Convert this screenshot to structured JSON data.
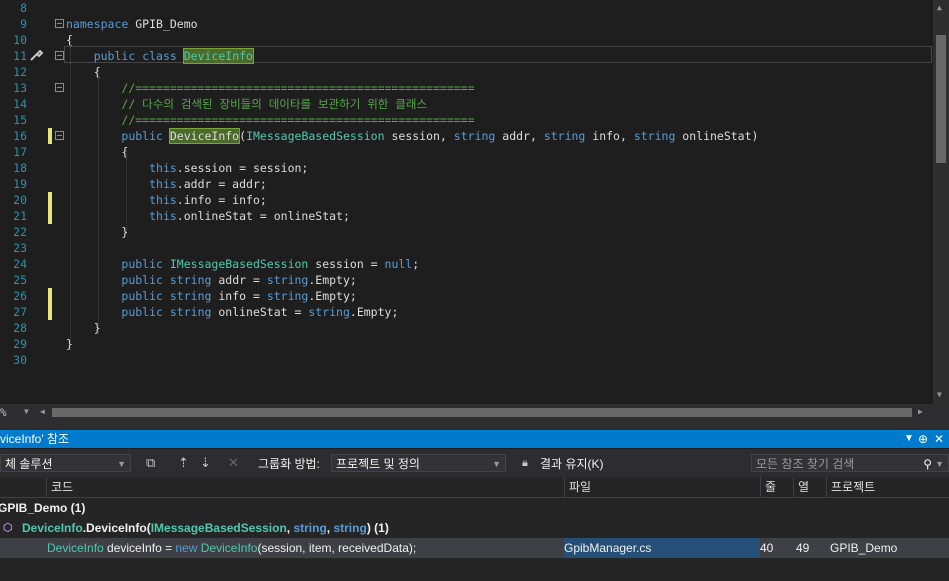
{
  "editor": {
    "lines": [
      {
        "n": "8",
        "html": ""
      },
      {
        "n": "9",
        "html": "<span class=\"kw\">namespace</span> GPIB_Demo"
      },
      {
        "n": "10",
        "html": "{"
      },
      {
        "n": "11",
        "html": "    <span class=\"kw\">public</span> <span class=\"kw\">class</span> <span class=\"ty hl\">DeviceInfo</span>"
      },
      {
        "n": "12",
        "html": "    {"
      },
      {
        "n": "13",
        "html": "        <span class=\"cm\">//=================================================</span>"
      },
      {
        "n": "14",
        "html": "        <span class=\"cm\">// 다수의 검색된 장비들의 데이타를 보관하기 위한 클래스</span>"
      },
      {
        "n": "15",
        "html": "        <span class=\"cm\">//=================================================</span>"
      },
      {
        "n": "16",
        "html": "        <span class=\"kw\">public</span> <span class=\"hl\">DeviceInfo</span>(<span class=\"ty\">IMessageBasedSession</span> session, <span class=\"kw\">string</span> addr, <span class=\"kw\">string</span> info, <span class=\"kw\">string</span> onlineStat)"
      },
      {
        "n": "17",
        "html": "        {"
      },
      {
        "n": "18",
        "html": "            <span class=\"kw\">this</span>.session = session;"
      },
      {
        "n": "19",
        "html": "            <span class=\"kw\">this</span>.addr = addr;"
      },
      {
        "n": "20",
        "html": "            <span class=\"kw\">this</span>.info = info;"
      },
      {
        "n": "21",
        "html": "            <span class=\"kw\">this</span>.onlineStat = onlineStat;"
      },
      {
        "n": "22",
        "html": "        }"
      },
      {
        "n": "23",
        "html": ""
      },
      {
        "n": "24",
        "html": "        <span class=\"kw\">public</span> <span class=\"ty\">IMessageBasedSession</span> session = <span class=\"kw\">null</span>;"
      },
      {
        "n": "25",
        "html": "        <span class=\"kw\">public</span> <span class=\"kw\">string</span> addr = <span class=\"kw\">string</span>.Empty;"
      },
      {
        "n": "26",
        "html": "        <span class=\"kw\">public</span> <span class=\"kw\">string</span> info = <span class=\"kw\">string</span>.Empty;"
      },
      {
        "n": "27",
        "html": "        <span class=\"kw\">public</span> <span class=\"kw\">string</span> onlineStat = <span class=\"kw\">string</span>.Empty;"
      },
      {
        "n": "28",
        "html": "    }"
      },
      {
        "n": "29",
        "html": "}"
      },
      {
        "n": "30",
        "html": ""
      }
    ],
    "zoom": "%"
  },
  "panel": {
    "title": "viceInfo' 참조",
    "title_icons": [
      "▾",
      "⊕",
      "✕"
    ]
  },
  "toolbar": {
    "scope": "체 솔루션",
    "group_label": "그룹화 방법:",
    "group_value": "프로젝트 및 정의",
    "keep_results": "결과 유지(K)",
    "search_placeholder": "모든 참조 찾기 검색"
  },
  "columns": {
    "code": "코드",
    "file": "파일",
    "line": "줄",
    "col": "열",
    "project": "프로젝트"
  },
  "results": {
    "project_group": "GPIB_Demo (1)",
    "definition_name": "DeviceInfo",
    "definition_dot": ".DeviceInfo(",
    "definition_type": "IMessageBasedSession",
    "definition_sep1": ", ",
    "definition_str1": "string",
    "definition_sep2": ", ",
    "definition_str2": "string",
    "definition_tail": ")",
    "definition_count": "(1)",
    "row": {
      "code_type": "DeviceInfo",
      "code_var": " deviceInfo = ",
      "code_new": "new ",
      "code_ctor": "DeviceInfo",
      "code_args": "(session, item, receivedData);",
      "file": "GpibManager.cs",
      "line": "40",
      "col": "49",
      "project": "GPIB_Demo"
    }
  }
}
